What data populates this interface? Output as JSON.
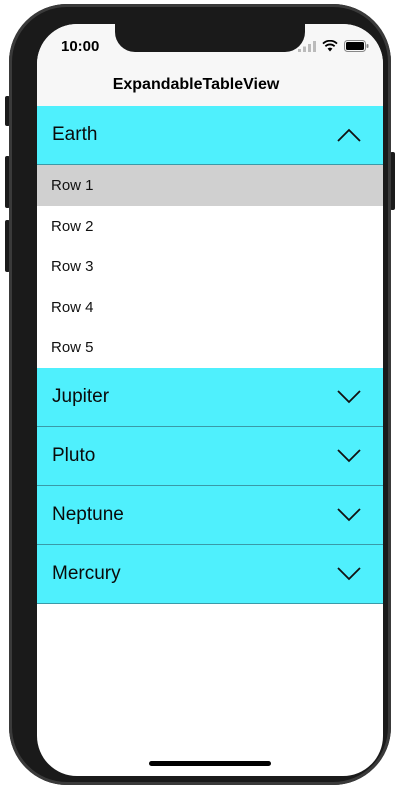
{
  "status_bar": {
    "time": "10:00"
  },
  "nav": {
    "title": "ExpandableTableView"
  },
  "sections": [
    {
      "title": "Earth",
      "expanded": true,
      "rows": [
        "Row 1",
        "Row 2",
        "Row 3",
        "Row 4",
        "Row 5"
      ],
      "selected_row": "Row 1"
    },
    {
      "title": "Jupiter",
      "expanded": false
    },
    {
      "title": "Pluto",
      "expanded": false
    },
    {
      "title": "Neptune",
      "expanded": false
    },
    {
      "title": "Mercury",
      "expanded": false
    }
  ],
  "colors": {
    "header_bg": "#4ff0fd",
    "selected_row_bg": "#d0d0d0",
    "device_frame": "#1a1a1a"
  },
  "icons": {
    "expanded": "chevron-up-icon",
    "collapsed": "chevron-down-icon"
  }
}
